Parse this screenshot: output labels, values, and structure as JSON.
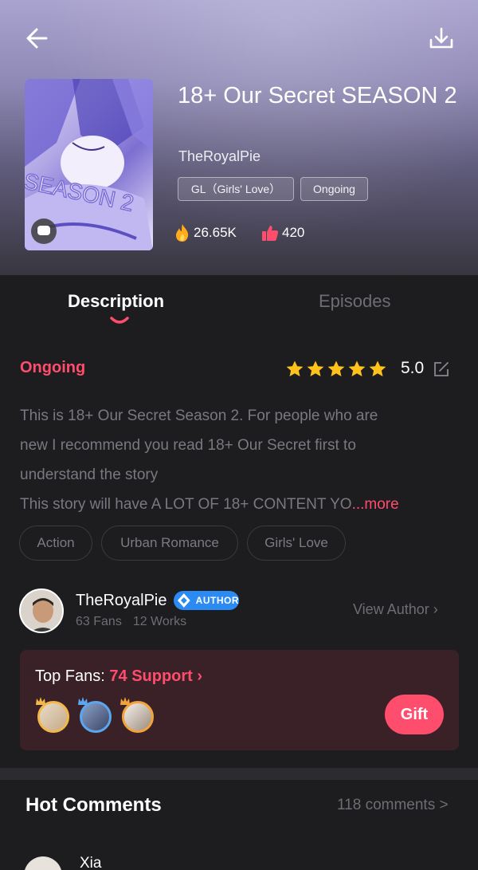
{
  "header": {
    "back_icon": "arrow-left-icon",
    "download_icon": "download-icon"
  },
  "comic": {
    "title": "18+ Our Secret SEASON 2",
    "cover_text": "SEASON 2",
    "author": "TheRoyalPie",
    "tags": [
      "GL（Girls' Love）",
      "Ongoing"
    ],
    "views": "26.65K",
    "likes": "420",
    "views_icon": "fire-icon",
    "likes_icon": "thumbs-up-icon"
  },
  "tabs": [
    {
      "label": "Description",
      "active": true
    },
    {
      "label": "Episodes",
      "active": false
    }
  ],
  "description": {
    "status": "Ongoing",
    "rating": "5.0",
    "stars": 5,
    "lines": [
      "This is 18+ Our Secret Season 2. For people who are",
      "new I recommend you read 18+ Our Secret first to",
      "understand the story",
      "This story will have A LOT OF 18+ CONTENT YO"
    ],
    "more_label": "...more",
    "genres": [
      "Action",
      "Urban Romance",
      "Girls' Love"
    ]
  },
  "author_card": {
    "name": "TheRoyalPie",
    "badge": "AUTHOR",
    "fans": "63 Fans",
    "works": "12 Works",
    "view_label": "View Author ›"
  },
  "fans": {
    "prefix": "Top Fans: ",
    "support": "74 Support ›",
    "gift_label": "Gift"
  },
  "comments": {
    "title": "Hot Comments",
    "count_label": "118 comments >",
    "first_commenter": "Xia"
  },
  "colors": {
    "accent": "#ff4d6d",
    "star": "#ffc21a",
    "author_badge": "#2b8bf2",
    "background": "#1d1c1f"
  }
}
